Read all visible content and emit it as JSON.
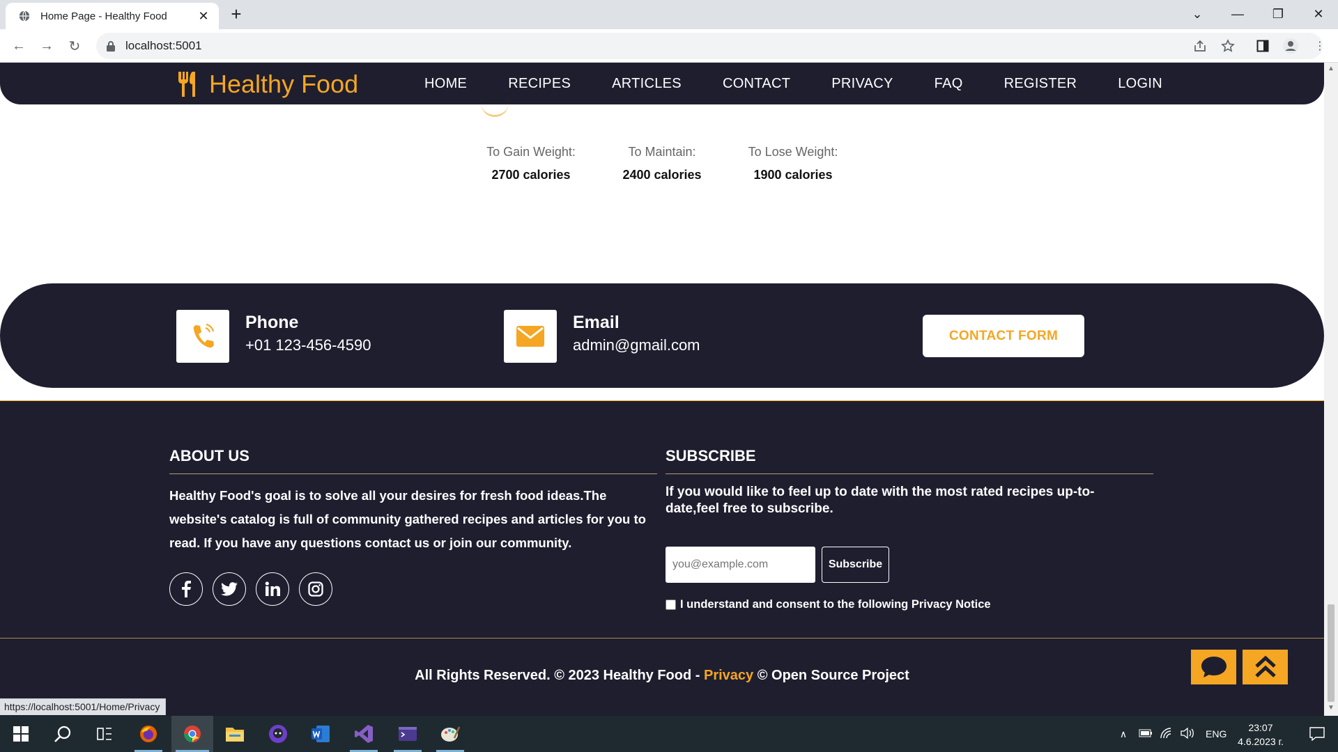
{
  "browser": {
    "tab_title": "Home Page - Healthy Food",
    "url": "localhost:5001",
    "status_url": "https://localhost:5001/Home/Privacy"
  },
  "site": {
    "brand": "Healthy Food",
    "menu": [
      "HOME",
      "RECIPES",
      "ARTICLES",
      "CONTACT",
      "PRIVACY",
      "FAQ",
      "REGISTER",
      "LOGIN"
    ],
    "colors": {
      "accent": "#f5a623",
      "dark": "#1e1e2f"
    }
  },
  "calories": [
    {
      "label": "To Gain Weight:",
      "value": "2700 calories"
    },
    {
      "label": "To Maintain:",
      "value": "2400 calories"
    },
    {
      "label": "To Lose Weight:",
      "value": "1900 calories"
    }
  ],
  "contact": {
    "phone_title": "Phone",
    "phone_value": "+01 123-456-4590",
    "email_title": "Email",
    "email_value": "admin@gmail.com",
    "form_button": "CONTACT FORM"
  },
  "footer": {
    "about_title": "ABOUT US",
    "about_text": "Healthy Food's goal is to solve all your desires for fresh food ideas.The website's catalog is full of community gathered recipes and articles for you to read. If you have any questions contact us or join our community.",
    "social": [
      "facebook-icon",
      "twitter-icon",
      "linkedin-icon",
      "instagram-icon"
    ],
    "subscribe_title": "SUBSCRIBE",
    "subscribe_text": "If you would like to feel up to date with the most rated recipes up-to-date,feel free to subscribe.",
    "email_placeholder": "you@example.com",
    "subscribe_button": "Subscribe",
    "consent": "I understand and consent to the following Privacy Notice",
    "copyright_pre": "All Rights Reserved. © 2023 Healthy Food - ",
    "copyright_link": "Privacy",
    "copyright_post": " © Open Source Project"
  },
  "taskbar": {
    "lang": "ENG",
    "time": "23:07",
    "date": "4.6.2023 г."
  }
}
